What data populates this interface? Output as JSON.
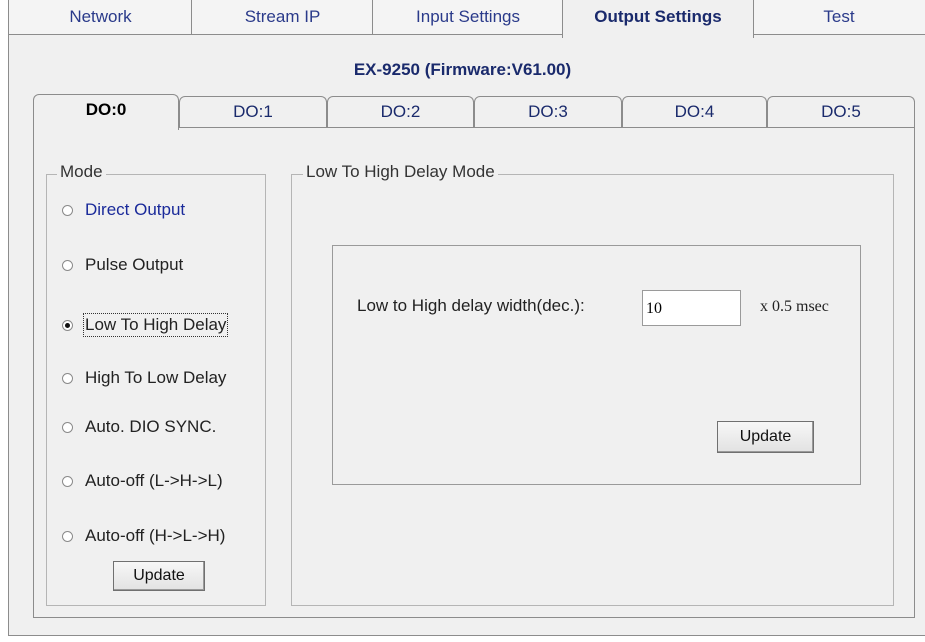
{
  "top_tabs": [
    "Network",
    "Stream IP",
    "Input Settings",
    "Output Settings",
    "Test"
  ],
  "active_top_tab": "Output Settings",
  "device_title": "EX-9250 (Firmware:V61.00)",
  "do_tabs": [
    "DO:0",
    "DO:1",
    "DO:2",
    "DO:3",
    "DO:4",
    "DO:5"
  ],
  "active_do_tab": "DO:0",
  "mode": {
    "legend": "Mode",
    "options": [
      "Direct Output",
      "Pulse Output",
      "Low To High Delay",
      "High To Low Delay",
      "Auto. DIO SYNC.",
      "Auto-off (L->H->L)",
      "Auto-off (H->L->H)"
    ],
    "selected": "Low To High Delay",
    "update_label": "Update"
  },
  "delay_mode": {
    "legend": "Low To High Delay Mode",
    "field_label": "Low to High delay width(dec.):",
    "field_value": "10",
    "unit": "x 0.5 msec",
    "update_label": "Update"
  }
}
